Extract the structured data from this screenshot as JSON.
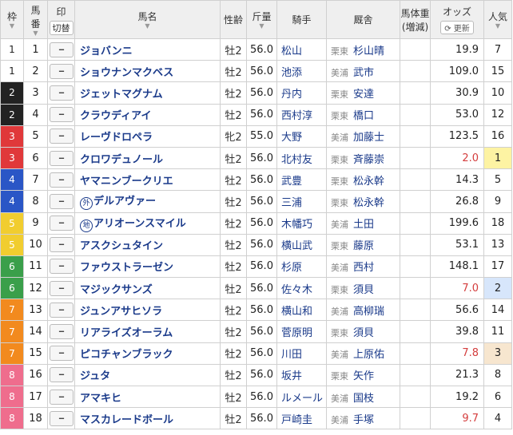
{
  "header": {
    "waku": "枠",
    "umaban_top": "馬",
    "umaban_bottom": "番",
    "mark_top": "印",
    "mark_toggle": "切替",
    "horse_name": "馬名",
    "sex_age": "性齢",
    "weight": "斤量",
    "jockey": "騎手",
    "stable": "厩舎",
    "body_weight_top": "馬体重",
    "body_weight_bottom": "(増減)",
    "odds": "オッズ",
    "update": "更新",
    "popularity_top": "人気",
    "sort_glyph": "▼"
  },
  "mark_placeholder": "--",
  "rows": [
    {
      "waku": "1",
      "umaban": "1",
      "name": "ジョバンニ",
      "tag": "",
      "sex_age": "牡2",
      "weight": "56.0",
      "jockey": "松山",
      "region": "栗東",
      "trainer": "杉山晴",
      "odds": "19.9",
      "hot": false,
      "pop": "7",
      "popClass": ""
    },
    {
      "waku": "1",
      "umaban": "2",
      "name": "ショウナンマクベス",
      "tag": "",
      "sex_age": "牡2",
      "weight": "56.0",
      "jockey": "池添",
      "region": "美浦",
      "trainer": "武市",
      "odds": "109.0",
      "hot": false,
      "pop": "15",
      "popClass": ""
    },
    {
      "waku": "2",
      "umaban": "3",
      "name": "ジェットマグナム",
      "tag": "",
      "sex_age": "牡2",
      "weight": "56.0",
      "jockey": "丹内",
      "region": "栗東",
      "trainer": "安達",
      "odds": "30.9",
      "hot": false,
      "pop": "10",
      "popClass": ""
    },
    {
      "waku": "2",
      "umaban": "4",
      "name": "クラウディアイ",
      "tag": "",
      "sex_age": "牡2",
      "weight": "56.0",
      "jockey": "西村淳",
      "region": "栗東",
      "trainer": "橋口",
      "odds": "53.0",
      "hot": false,
      "pop": "12",
      "popClass": ""
    },
    {
      "waku": "3",
      "umaban": "5",
      "name": "レーヴドロペラ",
      "tag": "",
      "sex_age": "牝2",
      "weight": "55.0",
      "jockey": "大野",
      "region": "美浦",
      "trainer": "加藤士",
      "odds": "123.5",
      "hot": false,
      "pop": "16",
      "popClass": ""
    },
    {
      "waku": "3",
      "umaban": "6",
      "name": "クロワデュノール",
      "tag": "",
      "sex_age": "牡2",
      "weight": "56.0",
      "jockey": "北村友",
      "region": "栗東",
      "trainer": "斉藤崇",
      "odds": "2.0",
      "hot": true,
      "pop": "1",
      "popClass": "p1"
    },
    {
      "waku": "4",
      "umaban": "7",
      "name": "ヤマニンブークリエ",
      "tag": "",
      "sex_age": "牡2",
      "weight": "56.0",
      "jockey": "武豊",
      "region": "栗東",
      "trainer": "松永幹",
      "odds": "14.3",
      "hot": false,
      "pop": "5",
      "popClass": ""
    },
    {
      "waku": "4",
      "umaban": "8",
      "name": "デルアヴァー",
      "tag": "外",
      "sex_age": "牡2",
      "weight": "56.0",
      "jockey": "三浦",
      "region": "栗東",
      "trainer": "松永幹",
      "odds": "26.8",
      "hot": false,
      "pop": "9",
      "popClass": ""
    },
    {
      "waku": "5",
      "umaban": "9",
      "name": "アリオーンスマイル",
      "tag": "地",
      "sex_age": "牡2",
      "weight": "56.0",
      "jockey": "木幡巧",
      "region": "美浦",
      "trainer": "土田",
      "odds": "199.6",
      "hot": false,
      "pop": "18",
      "popClass": ""
    },
    {
      "waku": "5",
      "umaban": "10",
      "name": "アスクシュタイン",
      "tag": "",
      "sex_age": "牡2",
      "weight": "56.0",
      "jockey": "横山武",
      "region": "栗東",
      "trainer": "藤原",
      "odds": "53.1",
      "hot": false,
      "pop": "13",
      "popClass": ""
    },
    {
      "waku": "6",
      "umaban": "11",
      "name": "ファウストラーゼン",
      "tag": "",
      "sex_age": "牡2",
      "weight": "56.0",
      "jockey": "杉原",
      "region": "美浦",
      "trainer": "西村",
      "odds": "148.1",
      "hot": false,
      "pop": "17",
      "popClass": ""
    },
    {
      "waku": "6",
      "umaban": "12",
      "name": "マジックサンズ",
      "tag": "",
      "sex_age": "牡2",
      "weight": "56.0",
      "jockey": "佐々木",
      "region": "栗東",
      "trainer": "須貝",
      "odds": "7.0",
      "hot": true,
      "pop": "2",
      "popClass": "p2"
    },
    {
      "waku": "7",
      "umaban": "13",
      "name": "ジュンアサヒソラ",
      "tag": "",
      "sex_age": "牡2",
      "weight": "56.0",
      "jockey": "横山和",
      "region": "美浦",
      "trainer": "高柳瑞",
      "odds": "56.6",
      "hot": false,
      "pop": "14",
      "popClass": ""
    },
    {
      "waku": "7",
      "umaban": "14",
      "name": "リアライズオーラム",
      "tag": "",
      "sex_age": "牡2",
      "weight": "56.0",
      "jockey": "菅原明",
      "region": "栗東",
      "trainer": "須貝",
      "odds": "39.8",
      "hot": false,
      "pop": "11",
      "popClass": ""
    },
    {
      "waku": "7",
      "umaban": "15",
      "name": "ピコチャンブラック",
      "tag": "",
      "sex_age": "牡2",
      "weight": "56.0",
      "jockey": "川田",
      "region": "美浦",
      "trainer": "上原佑",
      "odds": "7.8",
      "hot": true,
      "pop": "3",
      "popClass": "p3"
    },
    {
      "waku": "8",
      "umaban": "16",
      "name": "ジュタ",
      "tag": "",
      "sex_age": "牡2",
      "weight": "56.0",
      "jockey": "坂井",
      "region": "栗東",
      "trainer": "矢作",
      "odds": "21.3",
      "hot": false,
      "pop": "8",
      "popClass": ""
    },
    {
      "waku": "8",
      "umaban": "17",
      "name": "アマキヒ",
      "tag": "",
      "sex_age": "牡2",
      "weight": "56.0",
      "jockey": "ルメール",
      "region": "美浦",
      "trainer": "国枝",
      "odds": "19.2",
      "hot": false,
      "pop": "6",
      "popClass": ""
    },
    {
      "waku": "8",
      "umaban": "18",
      "name": "マスカレードボール",
      "tag": "",
      "sex_age": "牡2",
      "weight": "56.0",
      "jockey": "戸崎圭",
      "region": "美浦",
      "trainer": "手塚",
      "odds": "9.7",
      "hot": true,
      "pop": "4",
      "popClass": ""
    }
  ],
  "colors": {
    "waku1": "#ffffff",
    "waku2": "#222222",
    "waku3": "#e0383a",
    "waku4": "#2a56c6",
    "waku5": "#f1cd2f",
    "waku6": "#3a9f4a",
    "waku7": "#f28a1e",
    "waku8": "#ef6d8d",
    "link": "#1a3a8a",
    "odds_hot": "#d43d3d"
  }
}
